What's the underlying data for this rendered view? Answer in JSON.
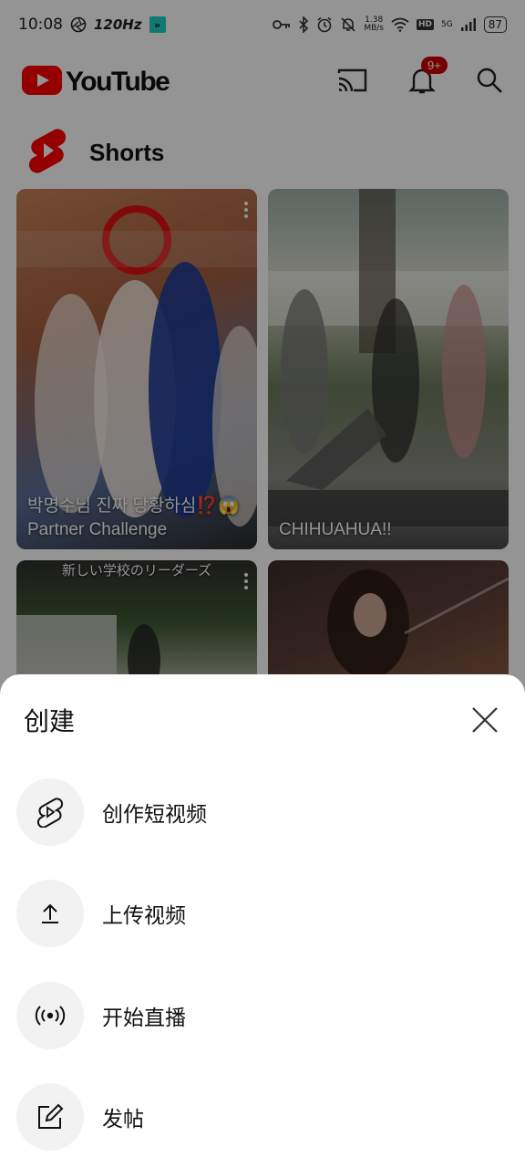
{
  "status_bar": {
    "time": "10:08",
    "refresh_rate": "120Hz",
    "net_speed_value": "1.38",
    "net_speed_unit": "MB/s",
    "hd_label": "HD",
    "network": "5G",
    "battery": "87",
    "badge_glyph": "»"
  },
  "top_bar": {
    "logo_text": "YouTube",
    "notification_badge": "9+",
    "icons": [
      "cast-icon",
      "bell-icon",
      "search-icon"
    ]
  },
  "shorts": {
    "section_title": "Shorts",
    "cards": [
      {
        "top_text": "",
        "caption": "박명수님 진짜 당황하심⁉️😱 Partner Challenge"
      },
      {
        "top_text": "",
        "caption": "CHIHUAHUA!!"
      },
      {
        "top_text": "新しい学校のリーダーズ",
        "caption": ""
      },
      {
        "top_text": "",
        "caption": ""
      }
    ]
  },
  "create_sheet": {
    "title": "创建",
    "items": [
      {
        "label": "创作短视频",
        "icon": "shorts-icon"
      },
      {
        "label": "上传视频",
        "icon": "upload-icon"
      },
      {
        "label": "开始直播",
        "icon": "live-icon"
      },
      {
        "label": "发帖",
        "icon": "edit-post-icon"
      }
    ]
  },
  "colors": {
    "youtube_red": "#ff0000",
    "badge_red": "#cc0000",
    "overlay": "rgba(0,0,0,0.42)",
    "icon_circle_bg": "#f2f2f2"
  }
}
